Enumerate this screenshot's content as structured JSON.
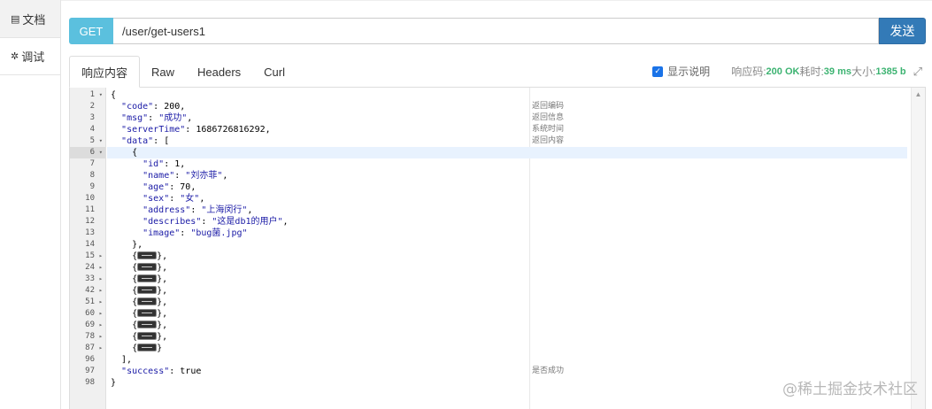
{
  "sidebar": {
    "items": [
      {
        "icon": "document-icon",
        "glyph": "▤",
        "label": "文档"
      },
      {
        "icon": "bug-icon",
        "glyph": "✲",
        "label": "调试"
      }
    ]
  },
  "request": {
    "method": "GET",
    "url": "/user/get-users1",
    "send_label": "发送"
  },
  "tabs": [
    {
      "label": "响应内容",
      "active": true
    },
    {
      "label": "Raw",
      "active": false
    },
    {
      "label": "Headers",
      "active": false
    },
    {
      "label": "Curl",
      "active": false
    }
  ],
  "response_meta": {
    "show_desc_label": "显示说明",
    "show_desc_checked": true,
    "code_label": "响应码:",
    "code_value": "200 OK",
    "time_label": "耗时:",
    "time_value": "39 ms",
    "size_label": "大小:",
    "size_value": "1385 b"
  },
  "editor": {
    "lines": [
      {
        "n": "1",
        "fold": "open",
        "text": "{",
        "comment": ""
      },
      {
        "n": "2",
        "fold": "",
        "text": "  \"code\": 200,",
        "comment": "返回编码"
      },
      {
        "n": "3",
        "fold": "",
        "text": "  \"msg\": \"成功\",",
        "comment": "返回信息"
      },
      {
        "n": "4",
        "fold": "",
        "text": "  \"serverTime\": 1686726816292,",
        "comment": "系统时间"
      },
      {
        "n": "5",
        "fold": "open",
        "text": "  \"data\": [",
        "comment": "返回内容"
      },
      {
        "n": "6",
        "fold": "open",
        "text": "    {",
        "comment": "",
        "active": true
      },
      {
        "n": "7",
        "fold": "",
        "text": "      \"id\": 1,",
        "comment": ""
      },
      {
        "n": "8",
        "fold": "",
        "text": "      \"name\": \"刘亦菲\",",
        "comment": ""
      },
      {
        "n": "9",
        "fold": "",
        "text": "      \"age\": 70,",
        "comment": ""
      },
      {
        "n": "10",
        "fold": "",
        "text": "      \"sex\": \"女\",",
        "comment": ""
      },
      {
        "n": "11",
        "fold": "",
        "text": "      \"address\": \"上海闵行\",",
        "comment": ""
      },
      {
        "n": "12",
        "fold": "",
        "text": "      \"describes\": \"这是db1的用户\",",
        "comment": ""
      },
      {
        "n": "13",
        "fold": "",
        "text": "      \"image\": \"bug菌.jpg\"",
        "comment": ""
      },
      {
        "n": "14",
        "fold": "",
        "text": "    },",
        "comment": ""
      },
      {
        "n": "15",
        "fold": "closed",
        "text": "    {",
        "tail": "},",
        "folded": true,
        "comment": ""
      },
      {
        "n": "24",
        "fold": "closed",
        "text": "    {",
        "tail": "},",
        "folded": true,
        "comment": ""
      },
      {
        "n": "33",
        "fold": "closed",
        "text": "    {",
        "tail": "},",
        "folded": true,
        "comment": ""
      },
      {
        "n": "42",
        "fold": "closed",
        "text": "    {",
        "tail": "},",
        "folded": true,
        "comment": ""
      },
      {
        "n": "51",
        "fold": "closed",
        "text": "    {",
        "tail": "},",
        "folded": true,
        "comment": ""
      },
      {
        "n": "60",
        "fold": "closed",
        "text": "    {",
        "tail": "},",
        "folded": true,
        "comment": ""
      },
      {
        "n": "69",
        "fold": "closed",
        "text": "    {",
        "tail": "},",
        "folded": true,
        "comment": ""
      },
      {
        "n": "78",
        "fold": "closed",
        "text": "    {",
        "tail": "},",
        "folded": true,
        "comment": ""
      },
      {
        "n": "87",
        "fold": "closed",
        "text": "    {",
        "tail": "}",
        "folded": true,
        "comment": ""
      },
      {
        "n": "96",
        "fold": "",
        "text": "  ],",
        "comment": ""
      },
      {
        "n": "97",
        "fold": "",
        "text": "  \"success\": true",
        "comment": "是否成功"
      },
      {
        "n": "98",
        "fold": "",
        "text": "}",
        "comment": ""
      }
    ]
  },
  "watermark": "@稀土掘金技术社区"
}
